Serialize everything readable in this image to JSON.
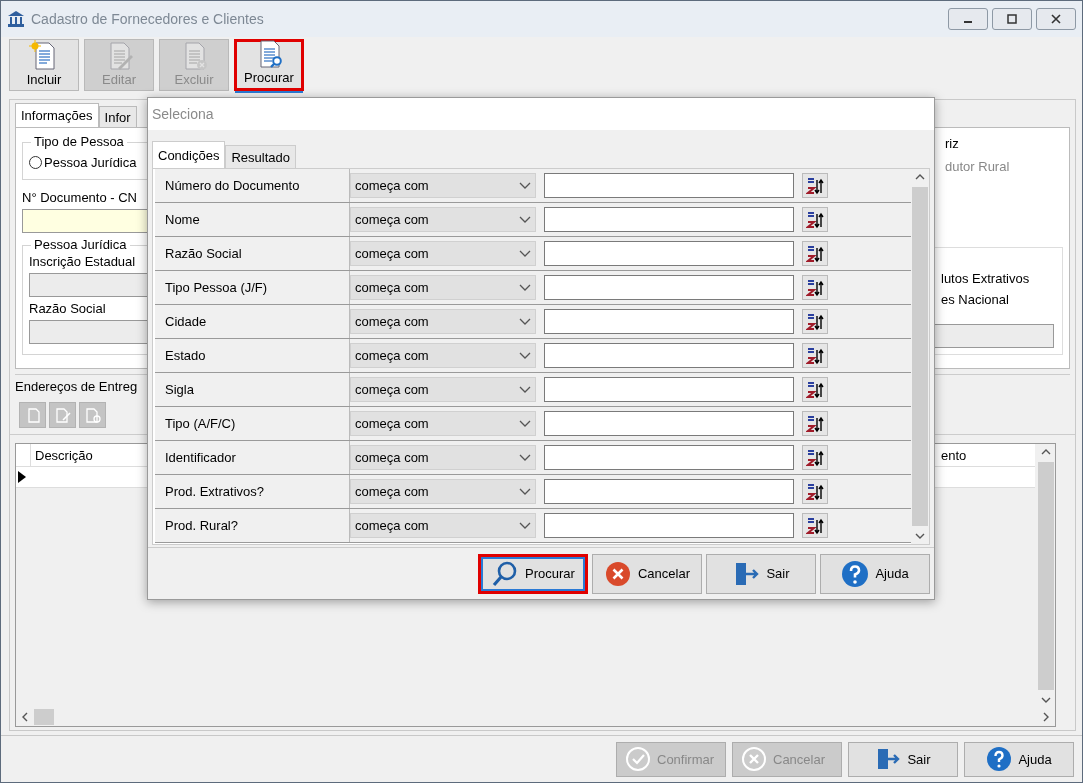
{
  "window": {
    "title": "Cadastro de Fornecedores e Clientes"
  },
  "toolbar": [
    {
      "label": "Incluir",
      "kind": "new",
      "disabled": false,
      "highlighted": false
    },
    {
      "label": "Editar",
      "kind": "edit",
      "disabled": true,
      "highlighted": false
    },
    {
      "label": "Excluir",
      "kind": "delete",
      "disabled": true,
      "highlighted": false
    },
    {
      "label": "Procurar",
      "kind": "search",
      "disabled": false,
      "highlighted": true
    }
  ],
  "form": {
    "tabs": [
      {
        "label": "Informações",
        "selected": true
      },
      {
        "label": "Infor",
        "selected": false
      }
    ],
    "person_type": {
      "legend": "Tipo de Pessoa",
      "option": {
        "label": "Pessoa Jurídica",
        "checked": false
      }
    },
    "document": {
      "label": "N° Documento - CN"
    },
    "legal_entity": {
      "legend": "Pessoa Jurídica",
      "fields": [
        {
          "label": "Inscrição Estadual"
        },
        {
          "label": "Razão Social"
        }
      ]
    },
    "right_options": [
      {
        "label": "riz",
        "disabled": false
      },
      {
        "label": "dutor Rural",
        "disabled": true
      }
    ],
    "right_group": [
      {
        "label": "lutos Extrativos"
      },
      {
        "label": "es Nacional"
      }
    ]
  },
  "addresses": {
    "title": "Endereços de Entreg",
    "columns": [
      "Descrição",
      "ento"
    ]
  },
  "footer": [
    {
      "label": "Confirmar",
      "kind": "confirm",
      "disabled": true
    },
    {
      "label": "Cancelar",
      "kind": "cancel",
      "disabled": true
    },
    {
      "label": "Sair",
      "kind": "exit",
      "disabled": false
    },
    {
      "label": "Ajuda",
      "kind": "help",
      "disabled": false
    }
  ],
  "dialog": {
    "title": "Seleciona",
    "tabs": [
      {
        "label": "Condições",
        "selected": true
      },
      {
        "label": "Resultado",
        "selected": false
      }
    ],
    "conditions": [
      {
        "field": "Número do Documento",
        "operator": "começa com"
      },
      {
        "field": "Nome",
        "operator": "começa com"
      },
      {
        "field": "Razão Social",
        "operator": "começa com"
      },
      {
        "field": "Tipo Pessoa (J/F)",
        "operator": "começa com"
      },
      {
        "field": "Cidade",
        "operator": "começa com"
      },
      {
        "field": "Estado",
        "operator": "começa com"
      },
      {
        "field": "Sigla",
        "operator": "começa com"
      },
      {
        "field": "Tipo (A/F/C)",
        "operator": "começa com"
      },
      {
        "field": "Identificador",
        "operator": "começa com"
      },
      {
        "field": "Prod. Extrativos?",
        "operator": "começa com"
      },
      {
        "field": "Prod. Rural?",
        "operator": "começa com"
      }
    ],
    "buttons": [
      {
        "label": "Procurar",
        "kind": "search",
        "disabled": false,
        "highlighted": true
      },
      {
        "label": "Cancelar",
        "kind": "cancel",
        "disabled": false,
        "highlighted": false
      },
      {
        "label": "Sair",
        "kind": "exit",
        "disabled": false,
        "highlighted": false
      },
      {
        "label": "Ajuda",
        "kind": "help",
        "disabled": false,
        "highlighted": false
      }
    ]
  }
}
